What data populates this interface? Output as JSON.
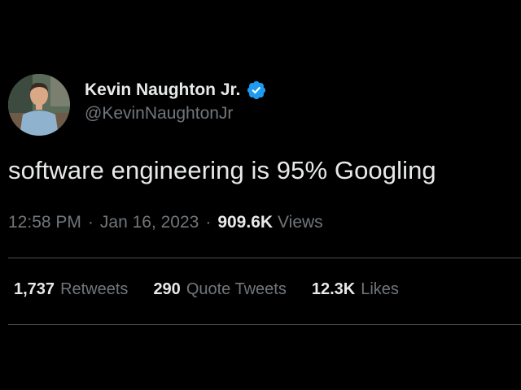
{
  "author": {
    "display_name": "Kevin Naughton Jr.",
    "handle": "@KevinNaughtonJr",
    "verified": true,
    "verified_icon": "verified-badge-icon"
  },
  "tweet": {
    "text": "software engineering is 95% Googling",
    "time": "12:58 PM",
    "separator": "·",
    "date": "Jan 16, 2023",
    "views_count": "909.6K",
    "views_label": "Views"
  },
  "stats": {
    "retweets": {
      "count": "1,737",
      "label": "Retweets"
    },
    "quote_tweets": {
      "count": "290",
      "label": "Quote Tweets"
    },
    "likes": {
      "count": "12.3K",
      "label": "Likes"
    }
  },
  "colors": {
    "background": "#000000",
    "primary_text": "#e7e9ea",
    "secondary_text": "#71767b",
    "verified_blue": "#1d9bf0",
    "divider": "#4a4e52"
  }
}
